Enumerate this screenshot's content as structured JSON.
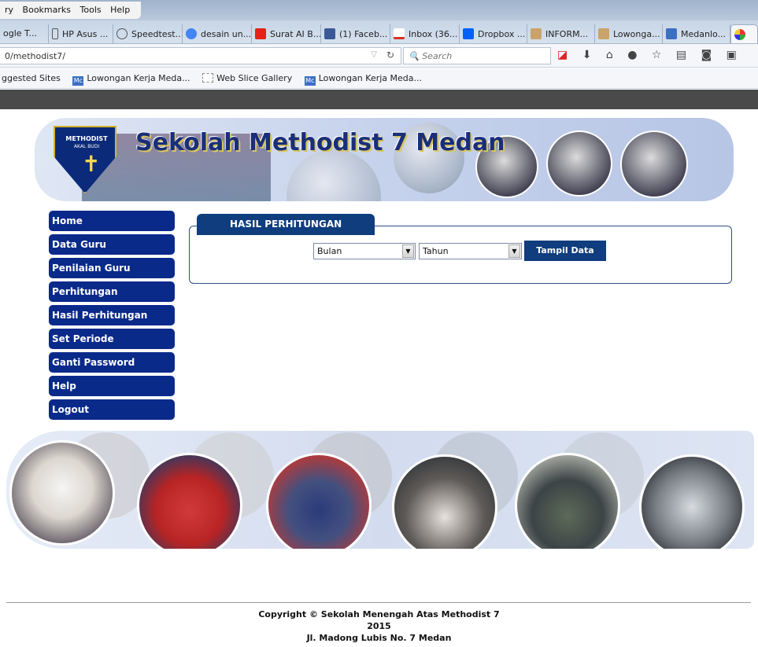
{
  "browser": {
    "menu": [
      "ry",
      "Bookmarks",
      "Tools",
      "Help"
    ],
    "tabs": [
      {
        "label": "ogle T...",
        "color": "#ffffff"
      },
      {
        "label": "HP Asus ...",
        "color": "#ffffff"
      },
      {
        "label": "Speedtest...",
        "color": "#ffffff"
      },
      {
        "label": "desain un...",
        "color": "#4285f4"
      },
      {
        "label": "Surat AI B...",
        "color": "#e62117"
      },
      {
        "label": "(1) Faceb...",
        "color": "#3b5998"
      },
      {
        "label": "Inbox (36...",
        "color": "#d93025"
      },
      {
        "label": "Dropbox ...",
        "color": "#0061ff"
      },
      {
        "label": "INFORM...",
        "color": "#c9a36b"
      },
      {
        "label": "Lowonga...",
        "color": "#c9a36b"
      },
      {
        "label": "Medanlo...",
        "color": "#3d6fc4"
      }
    ],
    "url": "0/methodist7/",
    "search_placeholder": "Search",
    "bookmarks": [
      {
        "label": "ggested Sites",
        "icon": ""
      },
      {
        "label": "Lowongan Kerja Meda...",
        "icon": "Mc"
      },
      {
        "label": "Web Slice Gallery",
        "icon": ""
      },
      {
        "label": "Lowongan Kerja Meda...",
        "icon": "Mc"
      }
    ]
  },
  "banner": {
    "title": "Sekolah Methodist 7 Medan",
    "logo_text_1": "METHODIST",
    "logo_text_2": "AKAL BUDI"
  },
  "sidebar": {
    "items": [
      "Home",
      "Data Guru",
      "Penilaian Guru",
      "Perhitungan",
      "Hasil Perhitungan",
      "Set Periode",
      "Ganti Password",
      "Help",
      "Logout"
    ]
  },
  "main": {
    "section_title": "HASIL PERHITUNGAN",
    "bulan_value": "Bulan",
    "tahun_value": "Tahun",
    "submit_label": "Tampil Data"
  },
  "footer": {
    "line1": "Copyright © Sekolah Menengah Atas Methodist 7",
    "line2": "2015",
    "line3": "Jl. Madong Lubis No. 7 Medan"
  }
}
